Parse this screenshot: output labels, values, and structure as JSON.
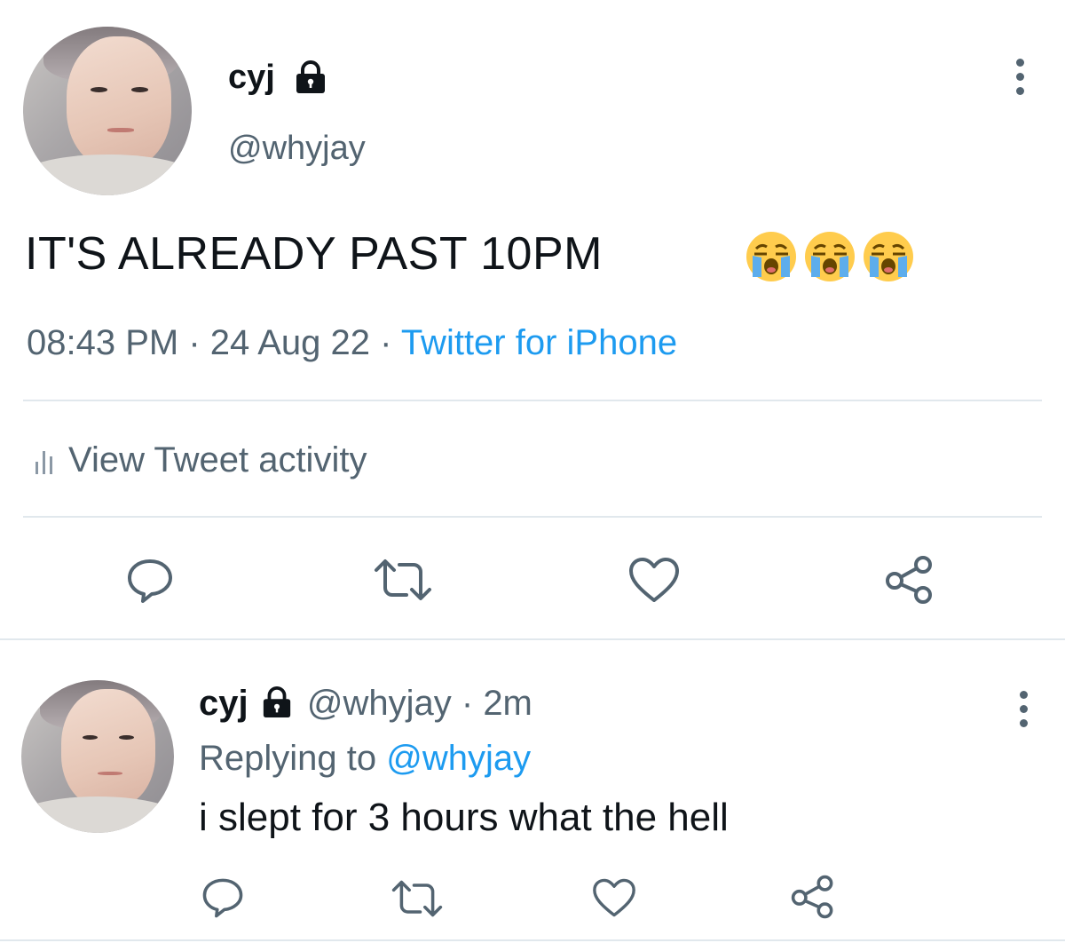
{
  "tweet": {
    "author": {
      "name": "cyj",
      "handle": "@whyjay",
      "protected": true
    },
    "text": "IT'S ALREADY PAST 10PM",
    "emoji": [
      "loudly-crying-face",
      "loudly-crying-face",
      "loudly-crying-face"
    ],
    "time": "08:43 PM",
    "sep1": "·",
    "date": "24 Aug 22",
    "sep2": "·",
    "source": "Twitter for iPhone",
    "activity_label": "View Tweet activity",
    "actions": [
      "reply-icon",
      "retweet-icon",
      "like-icon",
      "share-icon"
    ]
  },
  "reply": {
    "author": {
      "name": "cyj",
      "handle": "@whyjay",
      "protected": true
    },
    "sep": "·",
    "age": "2m",
    "replying_prefix": "Replying to",
    "replying_to": "@whyjay",
    "text": "i slept for 3 hours what the hell",
    "actions": [
      "reply-icon",
      "retweet-icon",
      "like-icon",
      "share-icon"
    ]
  },
  "colors": {
    "text": "#0f1419",
    "secondary": "#536471",
    "link": "#1d9bf0",
    "divider": "#e1e8ed"
  }
}
